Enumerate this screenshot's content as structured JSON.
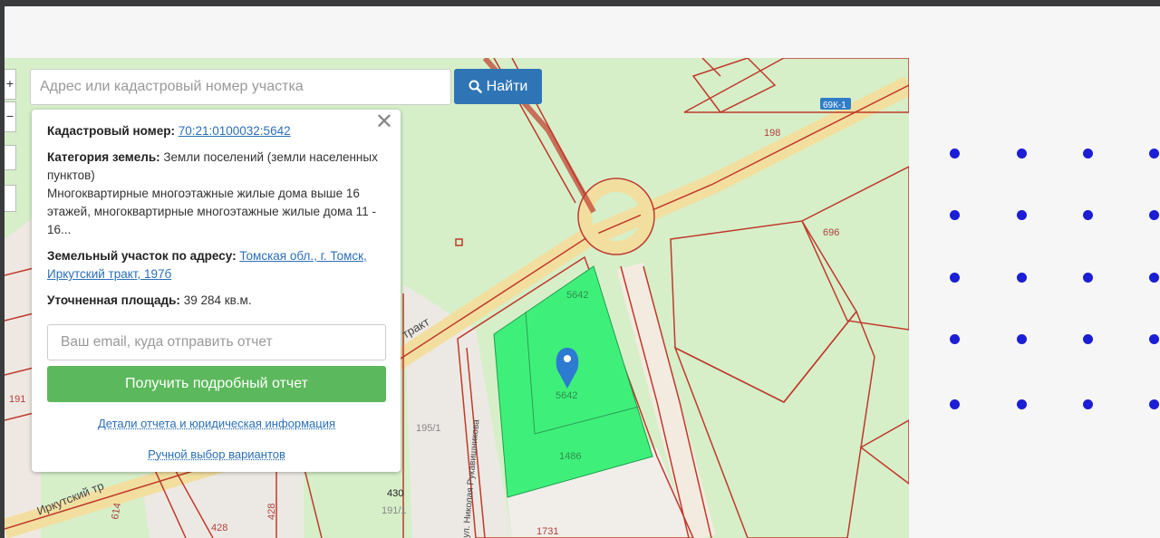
{
  "search": {
    "placeholder": "Адрес или кадастровый номер участка",
    "button_label": "Найти"
  },
  "map": {
    "zoom_in": "+",
    "zoom_out": "−",
    "labels": [
      "69К-1",
      "198",
      "696",
      "5642",
      "5642",
      "1486",
      "1731",
      "430",
      "191/1",
      "428",
      "428",
      "195/1",
      "191",
      "614",
      "тракт",
      "Иркутский тр",
      "ул. Николая Рукавишникова"
    ]
  },
  "popup": {
    "close": "✕",
    "cadastral_label": "Кадастровый номер:",
    "cadastral_value": "70:21:0100032:5642",
    "category_label": "Категория земель:",
    "category_value": "Земли поселений (земли населенных пунктов)",
    "usage_text": "Многоквартирные многоэтажные жилые дома выше 16 этажей, многоквартирные многоэтажные жилые дома 11 - 16...",
    "address_label": "Земельный участок по адресу:",
    "address_value": "Томская обл., г. Томск, Иркутский тракт, 197б",
    "area_label": "Уточненная площадь:",
    "area_value": "39 284 кв.м.",
    "email_placeholder": "Ваш email, куда отправить отчет",
    "report_button": "Получить подробный отчет",
    "details_link": "Детали отчета и юридическая информация",
    "manual_link": "Ручной выбор вариантов"
  },
  "colors": {
    "dots": "#1b1ed4",
    "search_button": "#2f75b5",
    "report_button": "#5cb85c",
    "parcel": "#3ef07a",
    "boundary": "#c0392b"
  }
}
